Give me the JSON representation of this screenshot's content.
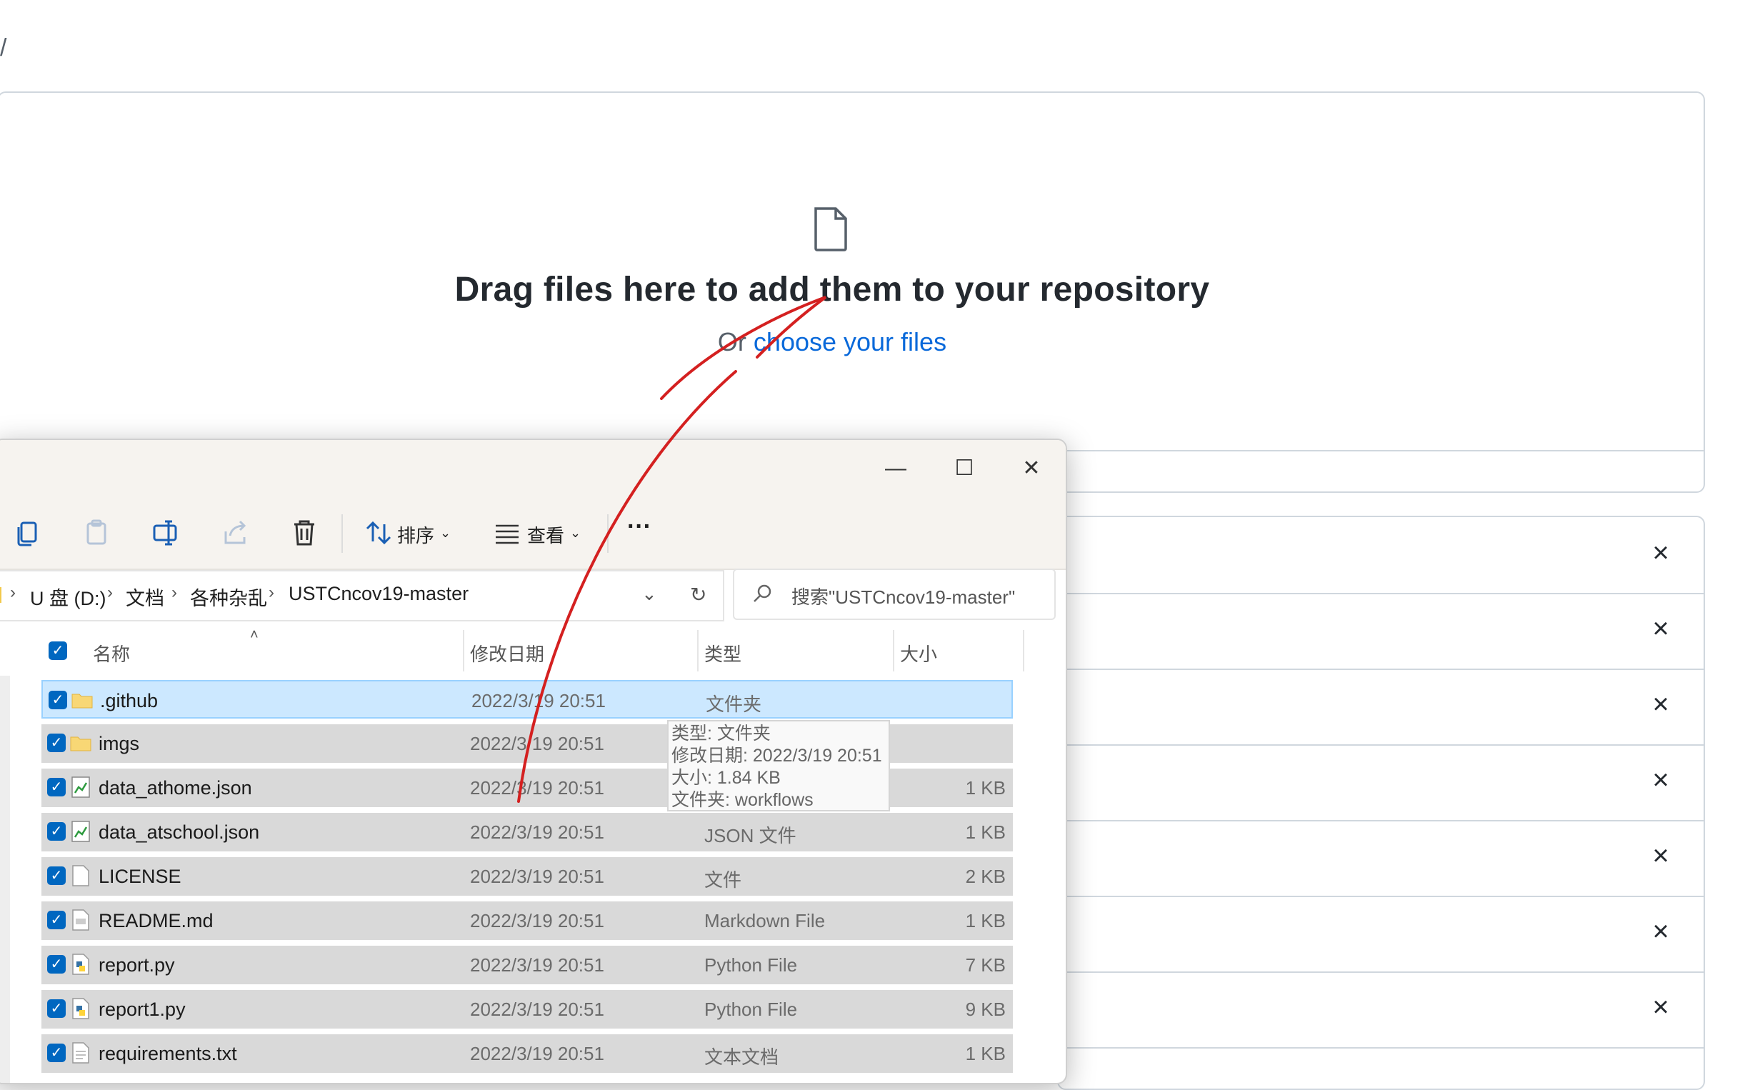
{
  "breadcrumb": "/",
  "drop_zone": {
    "title": "Drag files here to add them to your repository",
    "or_text": "Or ",
    "choose_link": "choose your files"
  },
  "upload_list": {
    "remove_icon": "×"
  },
  "explorer": {
    "window_controls": {
      "minimize": "—",
      "maximize": "☐",
      "close": "✕"
    },
    "toolbar": {
      "sort_label": "排序",
      "view_label": "查看",
      "more_label": "···"
    },
    "address": {
      "drive": "U 盘 (D:)",
      "folder1": "文档",
      "folder2": "各种杂乱",
      "folder3": "USTCncov19-master"
    },
    "search_placeholder": "搜索\"USTCncov19-master\"",
    "columns": {
      "name": "名称",
      "modified": "修改日期",
      "type": "类型",
      "size": "大小"
    },
    "files": [
      {
        "name": ".github",
        "date": "2022/3/19 20:51",
        "type": "文件夹",
        "size": "",
        "icon": "folder-icon"
      },
      {
        "name": "imgs",
        "date": "2022/3/19 20:51",
        "type": "",
        "size": "",
        "icon": "folder-icon"
      },
      {
        "name": "data_athome.json",
        "date": "2022/3/19 20:51",
        "type": "",
        "size": "1 KB",
        "icon": "json-file-icon"
      },
      {
        "name": "data_atschool.json",
        "date": "2022/3/19 20:51",
        "type": "JSON 文件",
        "size": "1 KB",
        "icon": "json-file-icon"
      },
      {
        "name": "LICENSE",
        "date": "2022/3/19 20:51",
        "type": "文件",
        "size": "2 KB",
        "icon": "blank-file-icon"
      },
      {
        "name": "README.md",
        "date": "2022/3/19 20:51",
        "type": "Markdown File",
        "size": "1 KB",
        "icon": "markdown-file-icon"
      },
      {
        "name": "report.py",
        "date": "2022/3/19 20:51",
        "type": "Python File",
        "size": "7 KB",
        "icon": "python-file-icon"
      },
      {
        "name": "report1.py",
        "date": "2022/3/19 20:51",
        "type": "Python File",
        "size": "9 KB",
        "icon": "python-file-icon"
      },
      {
        "name": "requirements.txt",
        "date": "2022/3/19 20:51",
        "type": "文本文档",
        "size": "1 KB",
        "icon": "text-file-icon"
      }
    ],
    "tooltip": {
      "line1": "类型: 文件夹",
      "line2": "修改日期: 2022/3/19 20:51",
      "line3": "大小: 1.84 KB",
      "line4": "文件夹: workflows"
    }
  },
  "colors": {
    "link": "#0969da",
    "checkbox": "#0067c0",
    "selection": "#cce8ff",
    "annotation": "#d42020"
  }
}
